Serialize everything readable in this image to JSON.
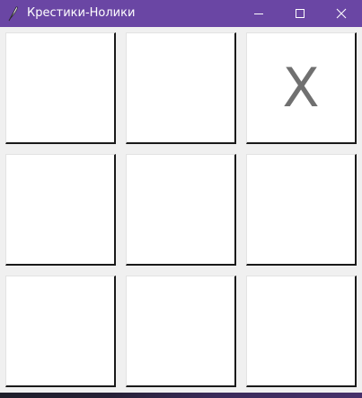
{
  "window": {
    "title": "Крестики-Нолики",
    "icon": "feather-icon",
    "controls": [
      "minimize-icon",
      "maximize-icon",
      "close-icon"
    ]
  },
  "board": {
    "cells": [
      "",
      "",
      "X",
      "",
      "",
      "",
      "",
      "",
      ""
    ]
  },
  "colors": {
    "titlebar": "#6a46a4",
    "mark": "#707070"
  }
}
